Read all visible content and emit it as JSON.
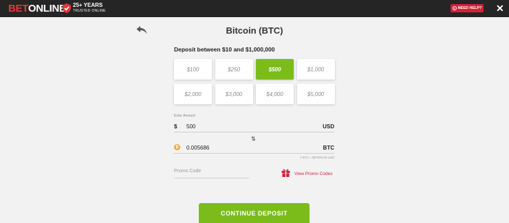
{
  "header": {
    "logo_bet": "BET",
    "logo_online": "ONLINE",
    "years_big": "25+ YEARS",
    "years_small": "TRUSTED ONLINE",
    "help_label": "NEED HELP?",
    "close_glyph": "✕"
  },
  "page": {
    "title": "Bitcoin (BTC)",
    "deposit_range": "Deposit between $10 and $1,000,000"
  },
  "amounts": [
    {
      "label": "$100",
      "selected": false
    },
    {
      "label": "$250",
      "selected": false
    },
    {
      "label": "$500",
      "selected": true
    },
    {
      "label": "$1,000",
      "selected": false
    },
    {
      "label": "$2,000",
      "selected": false
    },
    {
      "label": "$3,000",
      "selected": false
    },
    {
      "label": "$4,000",
      "selected": false
    },
    {
      "label": "$5,000",
      "selected": false
    }
  ],
  "form": {
    "enter_label": "Enter Amount:",
    "usd_symbol": "$",
    "usd_value": "500",
    "usd_code": "USD",
    "swap_icon": "⇅",
    "btc_value": "0.005686",
    "btc_code": "BTC",
    "rate_text": "1 BTC = $87929.63 USD",
    "promo_placeholder": "Promo Code",
    "promo_link": "View Promo Codes"
  },
  "actions": {
    "continue_label": "CONTINUE DEPOSIT"
  },
  "colors": {
    "accent_green": "#7cbc1a",
    "brand_red": "#d5203a",
    "bitcoin_orange": "#f7a12b"
  }
}
